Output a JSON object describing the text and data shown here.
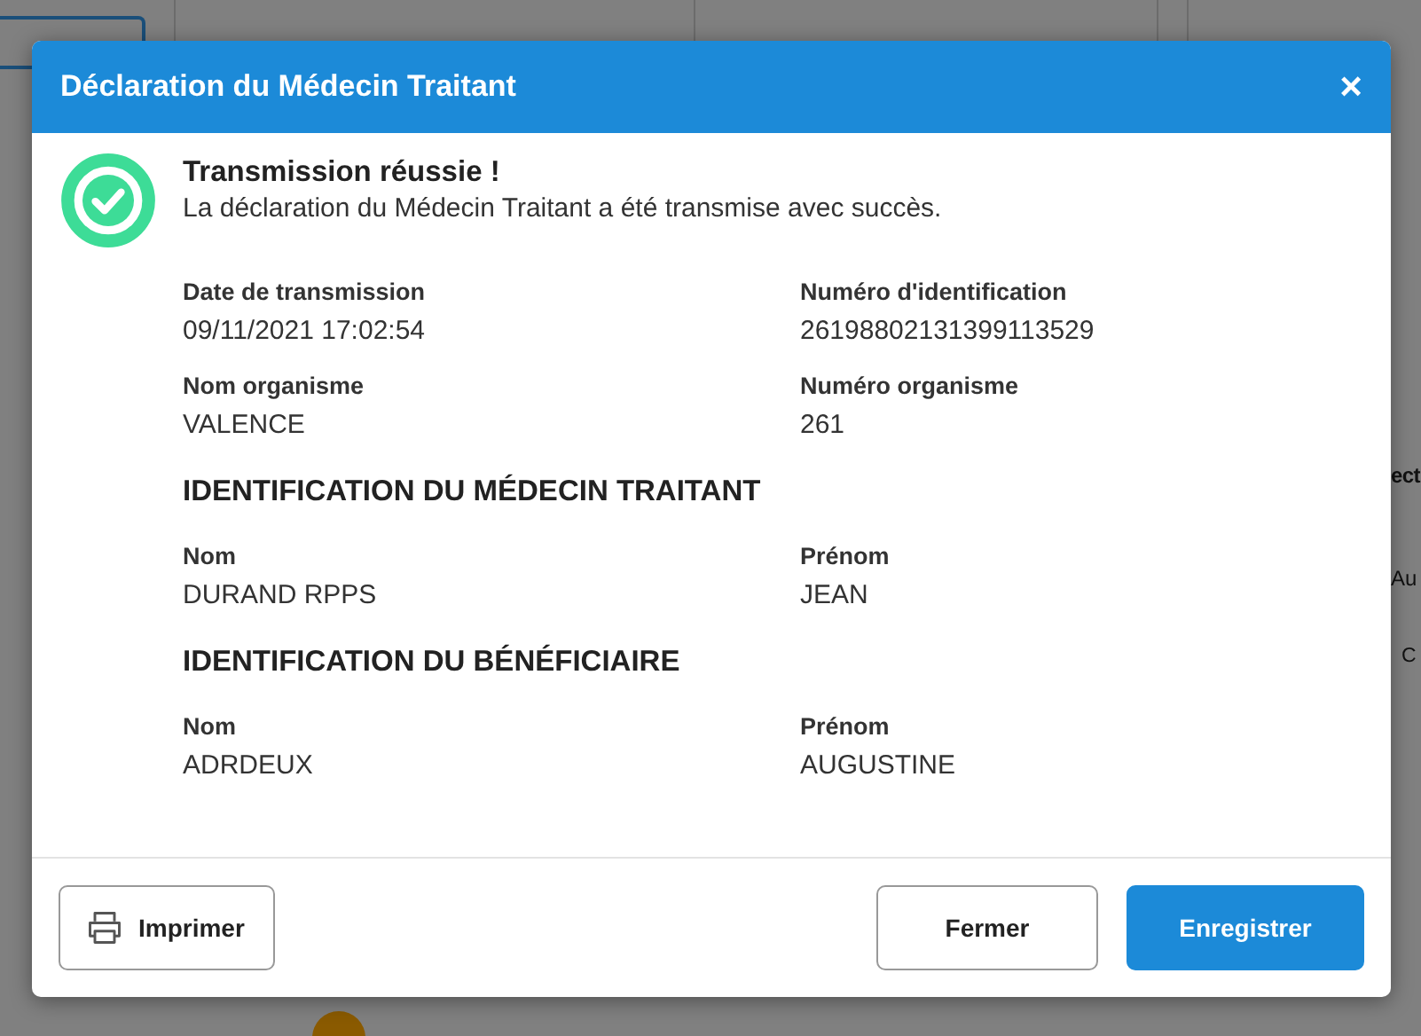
{
  "background": {
    "right_texts": [
      "ect",
      "Au",
      "C"
    ]
  },
  "dialog": {
    "title": "Déclaration du Médecin Traitant",
    "close": "×",
    "status": {
      "title": "Transmission réussie !",
      "message": "La déclaration du Médecin Traitant a été transmise avec succès."
    },
    "fields": [
      {
        "label": "Date de transmission",
        "value": "09/11/2021 17:02:54"
      },
      {
        "label": "Numéro d'identification",
        "value": "26198802131399113529"
      },
      {
        "label": "Nom organisme",
        "value": "VALENCE"
      },
      {
        "label": "Numéro organisme",
        "value": "261"
      }
    ],
    "sections": [
      {
        "title": "IDENTIFICATION DU MÉDECIN TRAITANT",
        "fields": [
          {
            "label": "Nom",
            "value": "DURAND RPPS"
          },
          {
            "label": "Prénom",
            "value": "JEAN"
          }
        ]
      },
      {
        "title": "IDENTIFICATION DU BÉNÉFICIAIRE",
        "fields": [
          {
            "label": "Nom",
            "value": "ADRDEUX"
          },
          {
            "label": "Prénom",
            "value": "AUGUSTINE"
          }
        ]
      }
    ],
    "buttons": [
      {
        "label": "Imprimer",
        "kind": "print"
      },
      {
        "label": "Fermer",
        "kind": "secondary"
      },
      {
        "label": "Enregistrer",
        "kind": "primary"
      }
    ]
  }
}
